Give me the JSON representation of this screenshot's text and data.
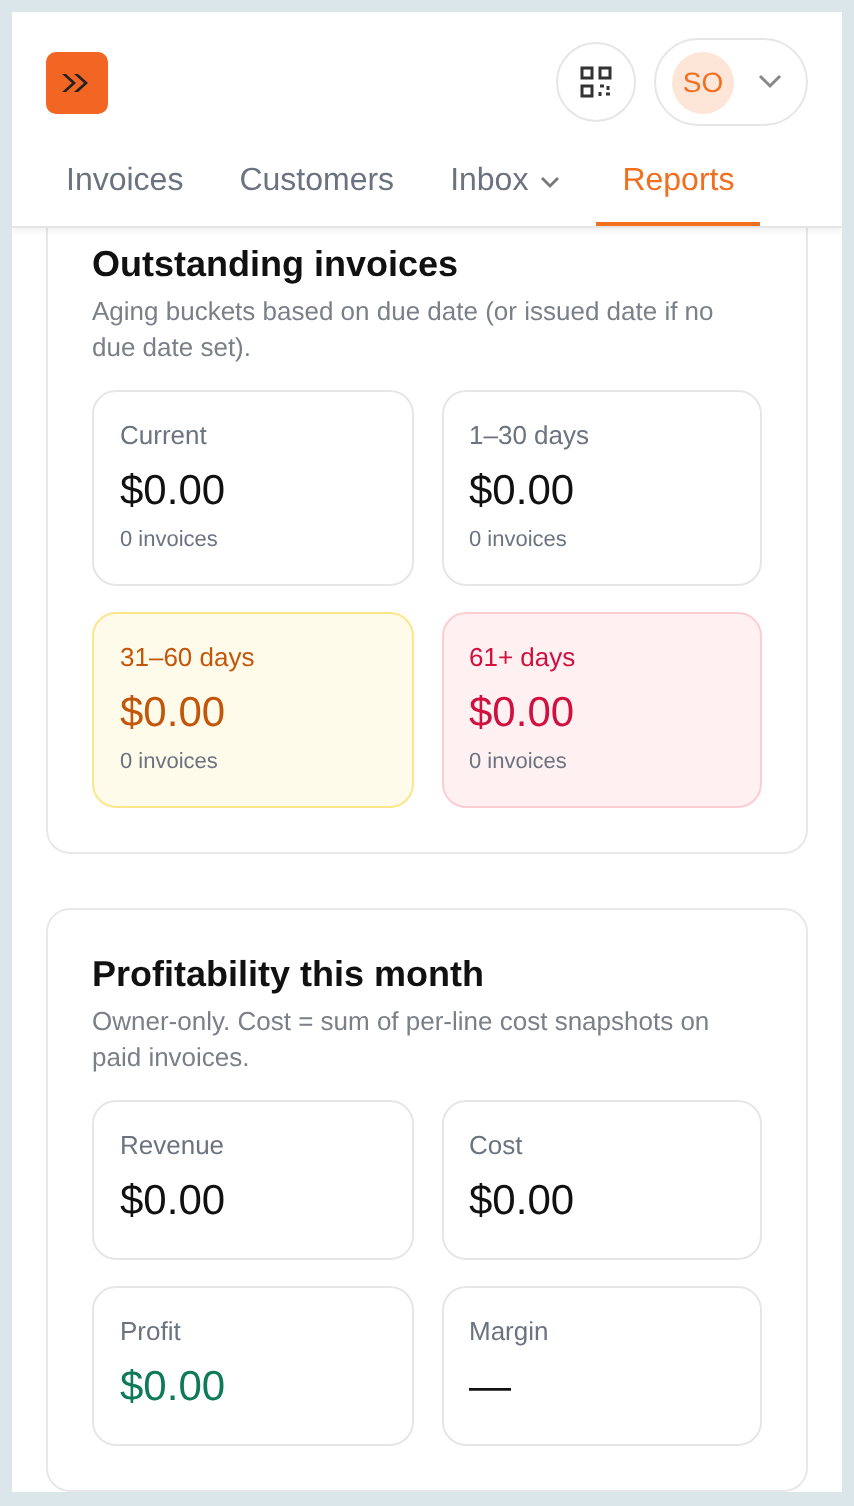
{
  "header": {
    "avatar_initials": "SO"
  },
  "tabs": [
    {
      "label": "Invoices",
      "selected": false,
      "has_menu": false
    },
    {
      "label": "Customers",
      "selected": false,
      "has_menu": false
    },
    {
      "label": "Inbox",
      "selected": false,
      "has_menu": true
    },
    {
      "label": "Reports",
      "selected": true,
      "has_menu": false
    }
  ],
  "sections": [
    {
      "title": "Outstanding invoices",
      "description": "Aging buckets based on due date (or issued date if no due date set).",
      "cards": [
        {
          "label": "Current",
          "value": "$0.00",
          "count": "0 invoices",
          "kind": "plain",
          "color": "#111111"
        },
        {
          "label": "1–30 days",
          "value": "$0.00",
          "count": "0 invoices",
          "kind": "plain",
          "color": "#111111"
        },
        {
          "label": "31–60 days",
          "value": "$0.00",
          "count": "0 invoices",
          "kind": "warning",
          "color": "#c2570c"
        },
        {
          "label": "61+ days",
          "value": "$0.00",
          "count": "0 invoices",
          "kind": "danger",
          "color": "#d0103f"
        }
      ]
    },
    {
      "title": "Profitability this month",
      "description": "Owner-only. Cost = sum of per-line cost snapshots on paid invoices.",
      "cards": [
        {
          "label": "Revenue",
          "value": "$0.00",
          "kind": "plain",
          "color": "#111111"
        },
        {
          "label": "Cost",
          "value": "$0.00",
          "kind": "plain",
          "color": "#111111"
        },
        {
          "label": "Profit",
          "value": "$0.00",
          "kind": "plain",
          "color": "#0f7a5a"
        },
        {
          "label": "Margin",
          "value": "—",
          "kind": "plain",
          "color": "#111111"
        }
      ]
    }
  ]
}
